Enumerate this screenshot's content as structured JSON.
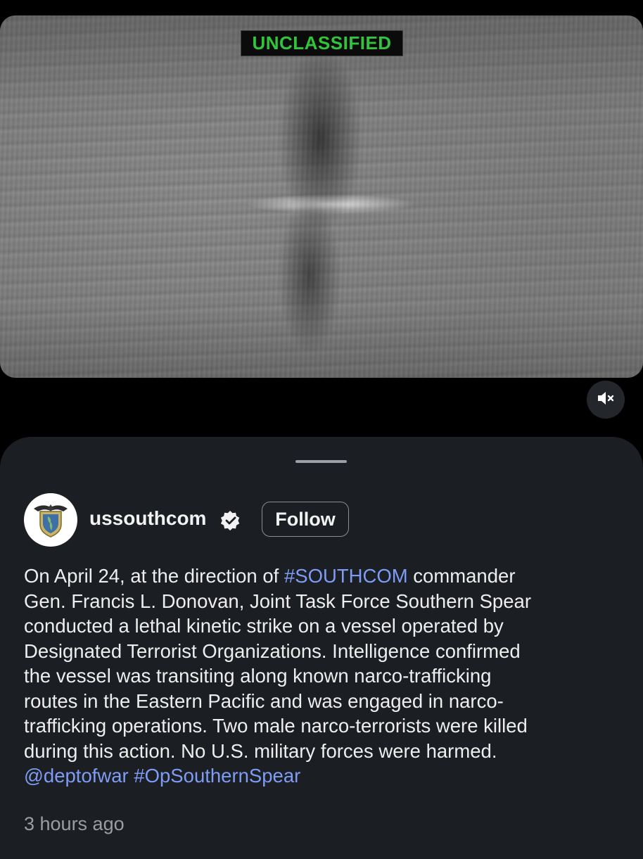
{
  "video": {
    "classification_label": "UNCLASSIFIED",
    "mute_icon": "speaker-muted-icon"
  },
  "post": {
    "avatar_icon": "command-emblem-icon",
    "username": "ussouthcom",
    "verified_icon": "verified-badge-icon",
    "follow_label": "Follow",
    "caption_segments": [
      {
        "text": "On April 24, at the direction of ",
        "type": "text"
      },
      {
        "text": "#SOUTHCOM",
        "type": "hashtag"
      },
      {
        "text": " commander Gen. Francis L. Donovan, Joint Task Force Southern Spear conducted a lethal kinetic strike on a vessel operated by Designated Terrorist Organizations. Intelligence confirmed the vessel was transiting along known narco-trafficking routes in the Eastern Pacific and was engaged in narco-trafficking operations. Two male narco-terrorists were killed during this action. No U.S. military forces were harmed. ",
        "type": "text"
      },
      {
        "text": "@deptofwar",
        "type": "mention"
      },
      {
        "text": " ",
        "type": "text"
      },
      {
        "text": "#OpSouthernSpear",
        "type": "hashtag"
      }
    ],
    "timestamp": "3 hours ago"
  },
  "colors": {
    "link": "#7f9cf5",
    "sheet_background": "#1b1e23",
    "classification_text": "#31c53b"
  }
}
